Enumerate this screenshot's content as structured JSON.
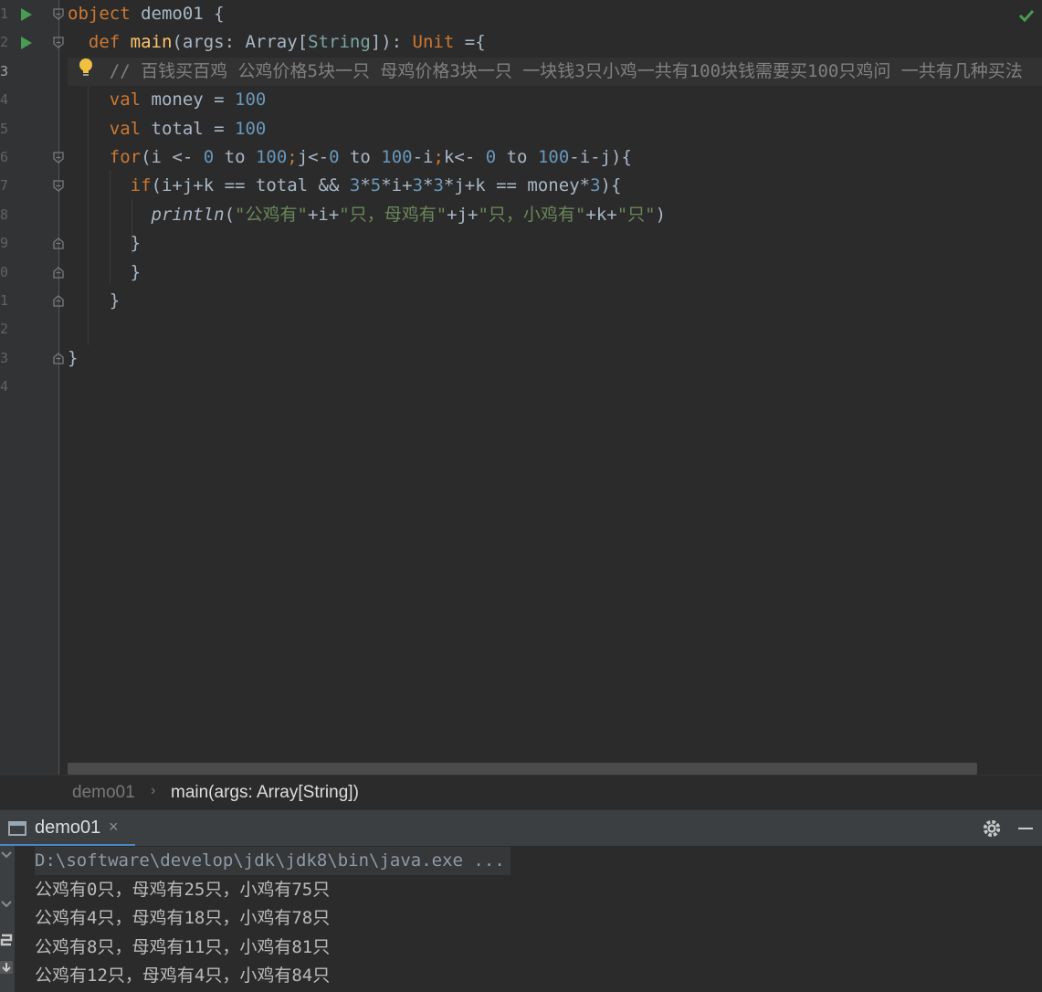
{
  "editor": {
    "line_numbers": [
      "1",
      "2",
      "3",
      "4",
      "5",
      "6",
      "7",
      "8",
      "9",
      "0",
      "1",
      "2",
      "3",
      "4"
    ],
    "current_line_index": 2,
    "lines": [
      {
        "tokens": [
          {
            "t": "object ",
            "c": "kw"
          },
          {
            "t": "demo01 {",
            "c": "type"
          }
        ]
      },
      {
        "tokens": [
          {
            "t": "  "
          },
          {
            "t": "def ",
            "c": "kw"
          },
          {
            "t": "main",
            "c": "fn"
          },
          {
            "t": "(args: Array["
          },
          {
            "t": "String",
            "c": "typestr"
          },
          {
            "t": "]): "
          },
          {
            "t": "Unit",
            "c": "kw"
          },
          {
            "t": " ={"
          }
        ]
      },
      {
        "tokens": [
          {
            "t": "    "
          },
          {
            "t": "// 百钱买百鸡 公鸡价格5块一只 母鸡价格3块一只 一块钱3只小鸡一共有100块钱需要买100只鸡问 一共有几种买法",
            "c": "cmt"
          }
        ]
      },
      {
        "tokens": [
          {
            "t": "    "
          },
          {
            "t": "val ",
            "c": "kw"
          },
          {
            "t": "money = "
          },
          {
            "t": "100",
            "c": "num"
          }
        ]
      },
      {
        "tokens": [
          {
            "t": "    "
          },
          {
            "t": "val ",
            "c": "kw"
          },
          {
            "t": "total = "
          },
          {
            "t": "100",
            "c": "num"
          }
        ]
      },
      {
        "tokens": [
          {
            "t": "    "
          },
          {
            "t": "for",
            "c": "kw"
          },
          {
            "t": "(i <- "
          },
          {
            "t": "0",
            "c": "num"
          },
          {
            "t": " to "
          },
          {
            "t": "100",
            "c": "num"
          },
          {
            "t": ";",
            "c": "kw"
          },
          {
            "t": "j<-"
          },
          {
            "t": "0",
            "c": "num"
          },
          {
            "t": " to "
          },
          {
            "t": "100",
            "c": "num"
          },
          {
            "t": "-i"
          },
          {
            "t": ";",
            "c": "kw"
          },
          {
            "t": "k<- "
          },
          {
            "t": "0",
            "c": "num"
          },
          {
            "t": " to "
          },
          {
            "t": "100",
            "c": "num"
          },
          {
            "t": "-i-j){"
          }
        ]
      },
      {
        "tokens": [
          {
            "t": "      "
          },
          {
            "t": "if",
            "c": "kw"
          },
          {
            "t": "(i+j+k == total && "
          },
          {
            "t": "3",
            "c": "num"
          },
          {
            "t": "*"
          },
          {
            "t": "5",
            "c": "num"
          },
          {
            "t": "*i+"
          },
          {
            "t": "3",
            "c": "num"
          },
          {
            "t": "*"
          },
          {
            "t": "3",
            "c": "num"
          },
          {
            "t": "*j+k == money*"
          },
          {
            "t": "3",
            "c": "num"
          },
          {
            "t": "){"
          }
        ]
      },
      {
        "tokens": [
          {
            "t": "        "
          },
          {
            "t": "println",
            "c": "ital"
          },
          {
            "t": "("
          },
          {
            "t": "\"公鸡有\"",
            "c": "str"
          },
          {
            "t": "+i+"
          },
          {
            "t": "\"只，母鸡有\"",
            "c": "str"
          },
          {
            "t": "+j+"
          },
          {
            "t": "\"只，小鸡有\"",
            "c": "str"
          },
          {
            "t": "+k+"
          },
          {
            "t": "\"只\"",
            "c": "str"
          },
          {
            "t": ")"
          }
        ]
      },
      {
        "tokens": [
          {
            "t": "      }"
          }
        ]
      },
      {
        "tokens": [
          {
            "t": "      }"
          }
        ]
      },
      {
        "tokens": [
          {
            "t": "    }"
          }
        ]
      },
      {
        "tokens": [
          {
            "t": ""
          }
        ]
      },
      {
        "tokens": [
          {
            "t": "}"
          }
        ]
      },
      {
        "tokens": [
          {
            "t": ""
          }
        ]
      }
    ]
  },
  "breadcrumb": {
    "item1": "demo01",
    "separator": "›",
    "item2": "main(args: Array[String])"
  },
  "run_panel": {
    "tab_label": "demo01",
    "close_glyph": "×"
  },
  "console": {
    "command": "D:\\software\\develop\\jdk\\jdk8\\bin\\java.exe ...",
    "output": [
      "公鸡有0只，母鸡有25只，小鸡有75只",
      "公鸡有4只，母鸡有18只，小鸡有78只",
      "公鸡有8只，母鸡有11只，小鸡有81只",
      "公鸡有12只，母鸡有4只，小鸡有84只"
    ]
  },
  "colors": {
    "keyword": "#cc7832",
    "function": "#ffc66d",
    "number": "#6897bb",
    "string": "#6a8759",
    "comment": "#808080",
    "run_arrow": "#499c54",
    "check": "#499c54"
  },
  "icons": [
    "run-arrow-icon",
    "fold-icon",
    "bulb-icon",
    "check-icon",
    "console-icon",
    "close-icon",
    "gear-icon",
    "minimize-icon"
  ]
}
